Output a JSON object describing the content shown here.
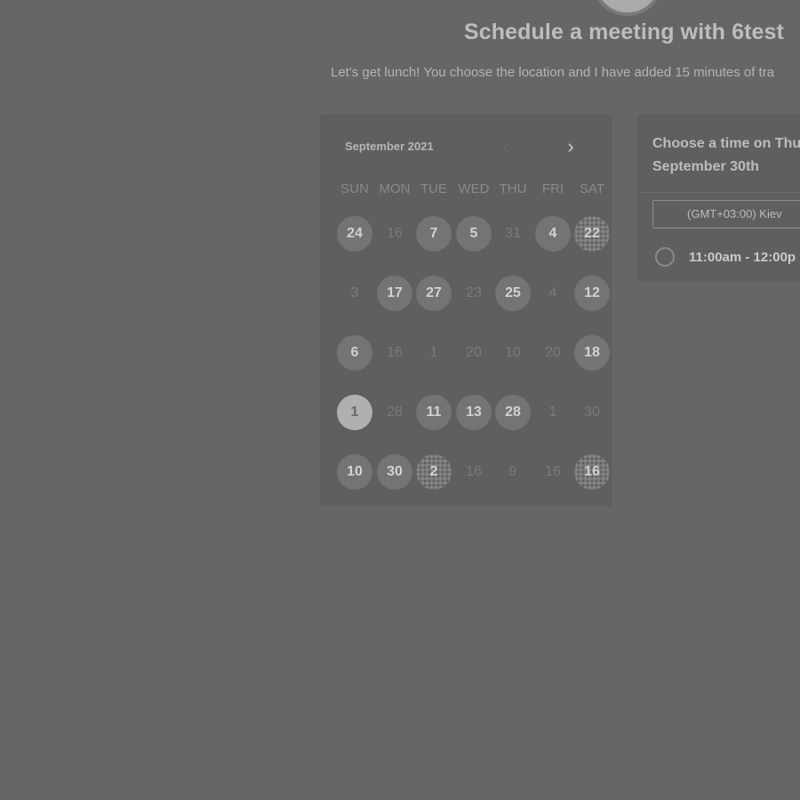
{
  "header": {
    "title": "Schedule a meeting with 6test",
    "subtitle": "Let's get lunch! You choose the location and I have added 15 minutes of tra"
  },
  "calendar": {
    "month_label": "September 2021",
    "prev_icon": "chevron-left-icon",
    "next_icon": "chevron-right-icon",
    "weekdays": [
      "SUN",
      "MON",
      "TUE",
      "WED",
      "THU",
      "FRI",
      "SAT"
    ],
    "weeks": [
      [
        {
          "t": "24",
          "s": "avail"
        },
        {
          "t": "16",
          "s": "dim"
        },
        {
          "t": "7",
          "s": "avail"
        },
        {
          "t": "5",
          "s": "avail"
        },
        {
          "t": "31",
          "s": "dim"
        },
        {
          "t": "4",
          "s": "avail"
        },
        {
          "t": "22",
          "s": "pattern"
        }
      ],
      [
        {
          "t": "3",
          "s": "dim"
        },
        {
          "t": "17",
          "s": "avail"
        },
        {
          "t": "27",
          "s": "avail"
        },
        {
          "t": "23",
          "s": "dim"
        },
        {
          "t": "25",
          "s": "avail"
        },
        {
          "t": "4",
          "s": "dim"
        },
        {
          "t": "12",
          "s": "avail"
        }
      ],
      [
        {
          "t": "6",
          "s": "avail"
        },
        {
          "t": "16",
          "s": "dim"
        },
        {
          "t": "1",
          "s": "dim"
        },
        {
          "t": "20",
          "s": "dim"
        },
        {
          "t": "10",
          "s": "dim"
        },
        {
          "t": "20",
          "s": "dim"
        },
        {
          "t": "18",
          "s": "avail"
        }
      ],
      [
        {
          "t": "1",
          "s": "selected"
        },
        {
          "t": "28",
          "s": "dim"
        },
        {
          "t": "11",
          "s": "avail"
        },
        {
          "t": "13",
          "s": "avail"
        },
        {
          "t": "28",
          "s": "avail"
        },
        {
          "t": "1",
          "s": "dim"
        },
        {
          "t": "30",
          "s": "dim"
        }
      ],
      [
        {
          "t": "10",
          "s": "avail"
        },
        {
          "t": "30",
          "s": "avail"
        },
        {
          "t": "2",
          "s": "pattern"
        },
        {
          "t": "16",
          "s": "dim"
        },
        {
          "t": "9",
          "s": "dim"
        },
        {
          "t": "16",
          "s": "dim"
        },
        {
          "t": "16",
          "s": "pattern"
        }
      ]
    ]
  },
  "time_panel": {
    "heading_line1": "Choose a time on Thu",
    "heading_line2": "September 30th",
    "timezone": "(GMT+03:00) Kiev",
    "slots": [
      {
        "label": "11:00am - 12:00p"
      }
    ]
  }
}
